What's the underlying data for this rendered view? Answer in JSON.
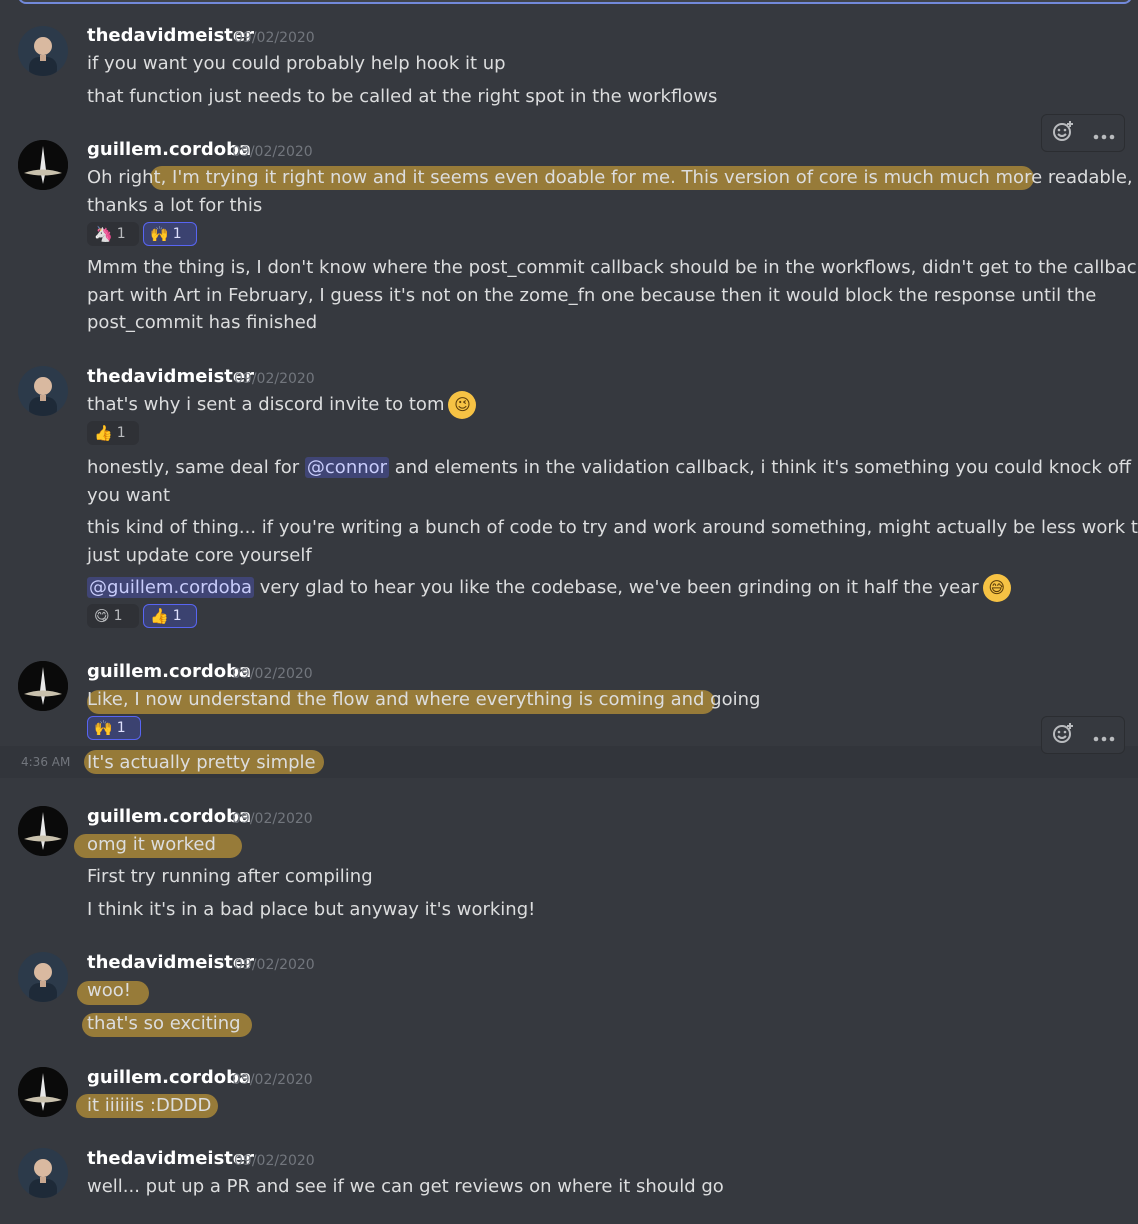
{
  "icons": {
    "add_reaction": "add-reaction-icon",
    "more": "more-options-icon"
  },
  "colors": {
    "highlight": "#b89138",
    "mention": "#5865f2",
    "background": "#36393f"
  },
  "blocks": [
    {
      "author": "thedavidmeister",
      "date": "09/02/2020",
      "lines": [
        "if you want you could probably help hook it up",
        "that function just needs to be called at the right spot in the workflows"
      ]
    },
    {
      "author": "guillem.cordoba",
      "date": "09/02/2020",
      "lines": [
        "Oh right, I'm trying it right now and it seems even doable for me. This version of core is much much more readable, so",
        "thanks a lot for this"
      ],
      "reactions": [
        {
          "emoji": "unicorn",
          "glyph": "🦄",
          "count": "1"
        },
        {
          "emoji": "raised-hands",
          "glyph": "🙌",
          "count": "1"
        }
      ],
      "lines2": [
        "Mmm the thing is, I don't know where the post_commit callback should be in the workflows, didn't get to the callbacks",
        "part with Art in February, I guess it's not on the zome_fn one because then it would block the response until the",
        "post_commit has finished"
      ]
    },
    {
      "author": "thedavidmeister",
      "date": "09/02/2020",
      "line1": "that's why i sent a discord invite to tom",
      "line1_emoji": "😉",
      "reactions1": [
        {
          "emoji": "thumbs-up",
          "glyph": "👍",
          "count": "1"
        }
      ],
      "line2_pre": "honestly, same deal for ",
      "line2_mention": "@connor",
      "line2_post": " and elements in the validation callback, i think it's something you could knock off if",
      "line3": "you want",
      "line4": "this kind of thing... if you're writing a bunch of code to try and work around something, might actually be less work to",
      "line5": "just update core yourself",
      "line6_mention": "@guillem.cordoba",
      "line6_post": " very glad to hear you like the codebase, we've been grinding on it half the year",
      "line6_emoji": "😅",
      "reactions2": [
        {
          "emoji": "yum",
          "glyph": "😋",
          "count": "1"
        },
        {
          "emoji": "thumbs-up",
          "glyph": "👍",
          "count": "1"
        }
      ]
    },
    {
      "author": "guillem.cordoba",
      "date": "09/02/2020",
      "line1": "Like, I now understand the flow and where everything is coming and going",
      "reactions": [
        {
          "emoji": "raised-hands",
          "glyph": "🙌",
          "count": "1"
        }
      ],
      "gutter_time": "4:36 AM",
      "line2": "It's actually pretty simple"
    },
    {
      "author": "guillem.cordoba",
      "date": "09/02/2020",
      "lines": [
        "omg it worked",
        "First try running after compiling",
        "I think it's in a bad place but anyway it's working!"
      ]
    },
    {
      "author": "thedavidmeister",
      "date": "09/02/2020",
      "lines": [
        "woo!",
        "that's so exciting"
      ]
    },
    {
      "author": "guillem.cordoba",
      "date": "09/02/2020",
      "lines": [
        "it iiiiiis :DDDD"
      ]
    },
    {
      "author": "thedavidmeister",
      "date": "09/02/2020",
      "lines": [
        "well... put up a PR and see if we can get reviews on where it should go"
      ]
    }
  ]
}
